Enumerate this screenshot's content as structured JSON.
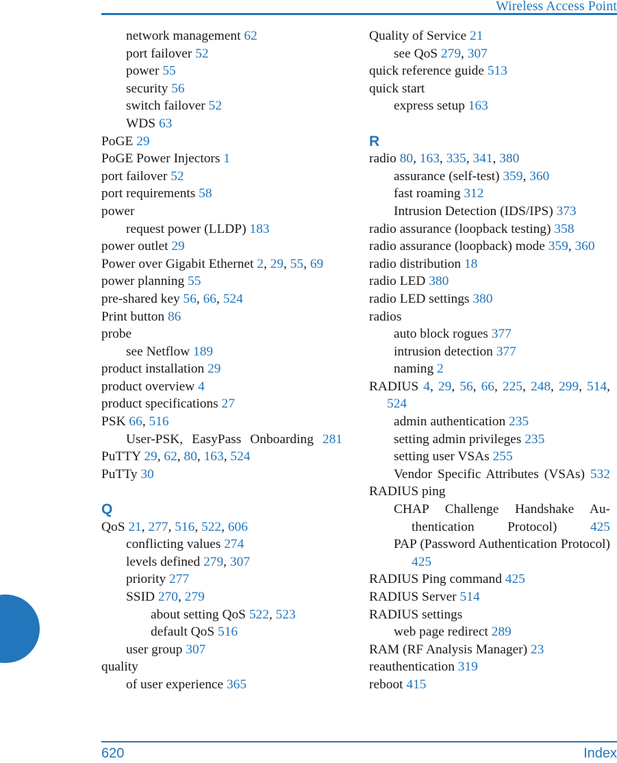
{
  "header": {
    "title": "Wireless Access Point"
  },
  "footer": {
    "page_number": "620",
    "section_label": "Index"
  },
  "colors": {
    "accent_blue": "#2376bc",
    "body_text": "#1a1a1a"
  },
  "columns": {
    "left": [
      {
        "level": 1,
        "text": "network management ",
        "pages": "62"
      },
      {
        "level": 1,
        "text": "port failover ",
        "pages": "52"
      },
      {
        "level": 1,
        "text": "power ",
        "pages": "55"
      },
      {
        "level": 1,
        "text": "security ",
        "pages": "56"
      },
      {
        "level": 1,
        "text": "switch failover ",
        "pages": "52"
      },
      {
        "level": 1,
        "text": "WDS ",
        "pages": "63"
      },
      {
        "level": 0,
        "text": "PoGE ",
        "pages": "29"
      },
      {
        "level": 0,
        "text": "PoGE Power Injectors ",
        "pages": "1"
      },
      {
        "level": 0,
        "text": "port failover ",
        "pages": "52"
      },
      {
        "level": 0,
        "text": "port requirements ",
        "pages": "58"
      },
      {
        "level": 0,
        "text": "power",
        "pages": ""
      },
      {
        "level": 1,
        "text": "request power (LLDP) ",
        "pages": "183"
      },
      {
        "level": 0,
        "text": "power outlet ",
        "pages": "29"
      },
      {
        "level": 0,
        "text": "Power over Gigabit Ethernet ",
        "pages": "2, 29, 55, 69"
      },
      {
        "level": 0,
        "text": "power planning ",
        "pages": "55"
      },
      {
        "level": 0,
        "text": "pre-shared key ",
        "pages": "56, 66, 524"
      },
      {
        "level": 0,
        "text": "Print button ",
        "pages": "86"
      },
      {
        "level": 0,
        "text": "probe",
        "pages": ""
      },
      {
        "level": 1,
        "text": "see Netflow ",
        "pages": "189"
      },
      {
        "level": 0,
        "text": "product installation ",
        "pages": "29"
      },
      {
        "level": 0,
        "text": "product overview ",
        "pages": "4"
      },
      {
        "level": 0,
        "text": "product specifications ",
        "pages": "27"
      },
      {
        "level": 0,
        "text": "PSK ",
        "pages": "66, 516"
      },
      {
        "level": 1,
        "text": "User-PSK, EasyPass Onboarding ",
        "pages": "281",
        "justify_last": true
      },
      {
        "level": 0,
        "text": "PuTTY ",
        "pages": "29, 62, 80, 163, 524"
      },
      {
        "level": 0,
        "text": "PuTTy ",
        "pages": "30"
      },
      {
        "letter": "Q"
      },
      {
        "level": 0,
        "text": "QoS ",
        "pages": "21, 277, 516, 522, 606"
      },
      {
        "level": 1,
        "text": "conflicting values ",
        "pages": "274"
      },
      {
        "level": 1,
        "text": "levels defined ",
        "pages": "279, 307"
      },
      {
        "level": 1,
        "text": "priority ",
        "pages": "277"
      },
      {
        "level": 1,
        "text": "SSID ",
        "pages": "270, 279"
      },
      {
        "level": 2,
        "text": "about setting QoS ",
        "pages": "522, 523"
      },
      {
        "level": 2,
        "text": "default QoS ",
        "pages": "516"
      },
      {
        "level": 1,
        "text": "user group ",
        "pages": "307"
      },
      {
        "level": 0,
        "text": "quality",
        "pages": ""
      },
      {
        "level": 1,
        "text": "of user experience ",
        "pages": "365"
      }
    ],
    "right": [
      {
        "level": 0,
        "text": "Quality of Service ",
        "pages": "21"
      },
      {
        "level": 1,
        "text": "see QoS ",
        "pages": "279, 307"
      },
      {
        "level": 0,
        "text": "quick reference guide ",
        "pages": "513"
      },
      {
        "level": 0,
        "text": "quick start",
        "pages": ""
      },
      {
        "level": 1,
        "text": "express setup ",
        "pages": "163"
      },
      {
        "letter": "R"
      },
      {
        "level": 0,
        "text": "radio ",
        "pages": "80, 163, 335, 341, 380"
      },
      {
        "level": 1,
        "text": "assurance (self-test) ",
        "pages": "359, 360"
      },
      {
        "level": 1,
        "text": "fast roaming ",
        "pages": "312"
      },
      {
        "level": 1,
        "text": "Intrusion Detection (IDS/IPS) ",
        "pages": "373"
      },
      {
        "level": 0,
        "text": "radio assurance (loopback testing) ",
        "pages": "358"
      },
      {
        "level": 0,
        "text": "radio assurance (loopback) mode ",
        "pages": "359, 360"
      },
      {
        "level": 0,
        "text": "radio distribution ",
        "pages": "18"
      },
      {
        "level": 0,
        "text": "radio LED ",
        "pages": "380"
      },
      {
        "level": 0,
        "text": "radio LED settings ",
        "pages": "380"
      },
      {
        "level": 0,
        "text": "radios",
        "pages": ""
      },
      {
        "level": 1,
        "text": "auto block rogues ",
        "pages": "377"
      },
      {
        "level": 1,
        "text": "intrusion detection ",
        "pages": "377"
      },
      {
        "level": 1,
        "text": "naming ",
        "pages": "2"
      },
      {
        "level": 0,
        "text": "RADIUS ",
        "pages": "4, 29, 56, 66, 225, 248, 299, 514, 524",
        "justify_first": true
      },
      {
        "level": 1,
        "text": "admin authentication ",
        "pages": "235"
      },
      {
        "level": 1,
        "text": "setting admin privileges ",
        "pages": "235"
      },
      {
        "level": 1,
        "text": "setting user VSAs ",
        "pages": "255"
      },
      {
        "level": 1,
        "text": "Vendor Specific Attributes (VSAs) ",
        "pages": "532",
        "justify_last": true
      },
      {
        "level": 0,
        "text": "RADIUS ping",
        "pages": ""
      },
      {
        "level": 1,
        "text": "CHAP Challenge Handshake Au-thentication Protocol) ",
        "pages": "425",
        "justify_last": true
      },
      {
        "level": 1,
        "text": "PAP (Password Authentication Protocol) ",
        "pages": "425",
        "justify_last": true
      },
      {
        "level": 0,
        "text": "RADIUS Ping command ",
        "pages": "425"
      },
      {
        "level": 0,
        "text": "RADIUS Server ",
        "pages": "514"
      },
      {
        "level": 0,
        "text": "RADIUS settings",
        "pages": ""
      },
      {
        "level": 1,
        "text": "web page redirect ",
        "pages": "289"
      },
      {
        "level": 0,
        "text": "RAM (RF Analysis Manager) ",
        "pages": "23"
      },
      {
        "level": 0,
        "text": "reauthentication ",
        "pages": "319"
      },
      {
        "level": 0,
        "text": "reboot ",
        "pages": "415"
      }
    ]
  }
}
